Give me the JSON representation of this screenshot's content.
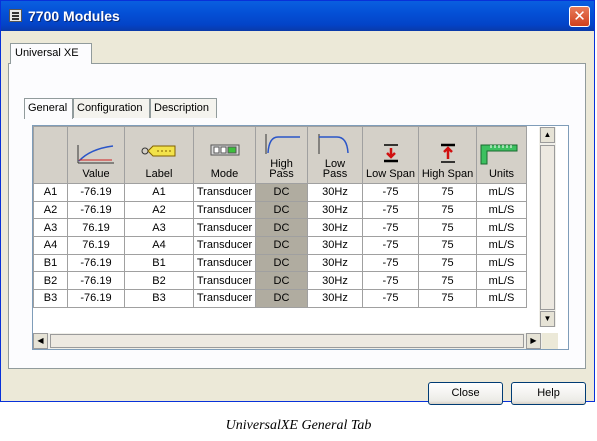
{
  "window": {
    "title": "7700 Modules"
  },
  "outer_tab": {
    "label": "Universal XE"
  },
  "inner_tabs": [
    {
      "label": "General",
      "active": true
    },
    {
      "label": "Configuration",
      "active": false
    },
    {
      "label": "Description",
      "active": false
    }
  ],
  "grid": {
    "columns": [
      {
        "label": "Value",
        "icon": "curve-graph-icon"
      },
      {
        "label": "Label",
        "icon": "tag-label-icon"
      },
      {
        "label": "Mode",
        "icon": "mode-panel-icon"
      },
      {
        "label": "High\nPass",
        "icon": "high-pass-filter-icon"
      },
      {
        "label": "Low\nPass",
        "icon": "low-pass-filter-icon"
      },
      {
        "label": "Low Span",
        "icon": "low-span-arrow-icon"
      },
      {
        "label": "High Span",
        "icon": "high-span-arrow-icon"
      },
      {
        "label": "Units",
        "icon": "ruler-units-icon"
      }
    ],
    "rows": [
      {
        "channel": "A1",
        "cells": [
          "-76.19",
          "A1",
          "Transducer",
          "DC",
          "30Hz",
          "-75",
          "75",
          "mL/S"
        ]
      },
      {
        "channel": "A2",
        "cells": [
          "-76.19",
          "A2",
          "Transducer",
          "DC",
          "30Hz",
          "-75",
          "75",
          "mL/S"
        ]
      },
      {
        "channel": "A3",
        "cells": [
          "76.19",
          "A3",
          "Transducer",
          "DC",
          "30Hz",
          "-75",
          "75",
          "mL/S"
        ]
      },
      {
        "channel": "A4",
        "cells": [
          "76.19",
          "A4",
          "Transducer",
          "DC",
          "30Hz",
          "-75",
          "75",
          "mL/S"
        ]
      },
      {
        "channel": "B1",
        "cells": [
          "-76.19",
          "B1",
          "Transducer",
          "DC",
          "30Hz",
          "-75",
          "75",
          "mL/S"
        ]
      },
      {
        "channel": "B2",
        "cells": [
          "-76.19",
          "B2",
          "Transducer",
          "DC",
          "30Hz",
          "-75",
          "75",
          "mL/S"
        ]
      },
      {
        "channel": "B3",
        "cells": [
          "-76.19",
          "B3",
          "Transducer",
          "DC",
          "30Hz",
          "-75",
          "75",
          "mL/S"
        ]
      }
    ]
  },
  "buttons": {
    "close": "Close",
    "help": "Help"
  },
  "caption": "UniversalXE General Tab",
  "colors": {
    "titlebar": "#0450d6",
    "high_pass_column": "#b0aca0",
    "dialog": "#ece9d8"
  }
}
